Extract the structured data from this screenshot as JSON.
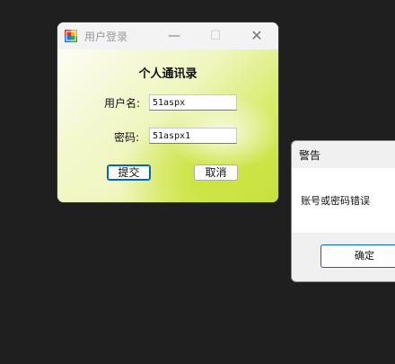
{
  "login_window": {
    "title": "用户登录",
    "heading": "个人通讯录",
    "username_label": "用户名:",
    "username_value": "51aspx",
    "password_label": "密码:",
    "password_value": "51aspx1",
    "submit_label": "提交",
    "cancel_label": "取消",
    "controls": {
      "minimize": "—",
      "maximize": "☐",
      "close": "✕"
    }
  },
  "alert_dialog": {
    "title": "警告",
    "message": "账号或密码错误",
    "ok_label": "确定"
  },
  "icons": [
    "app-icon",
    "minimize-icon",
    "maximize-icon",
    "close-icon"
  ]
}
